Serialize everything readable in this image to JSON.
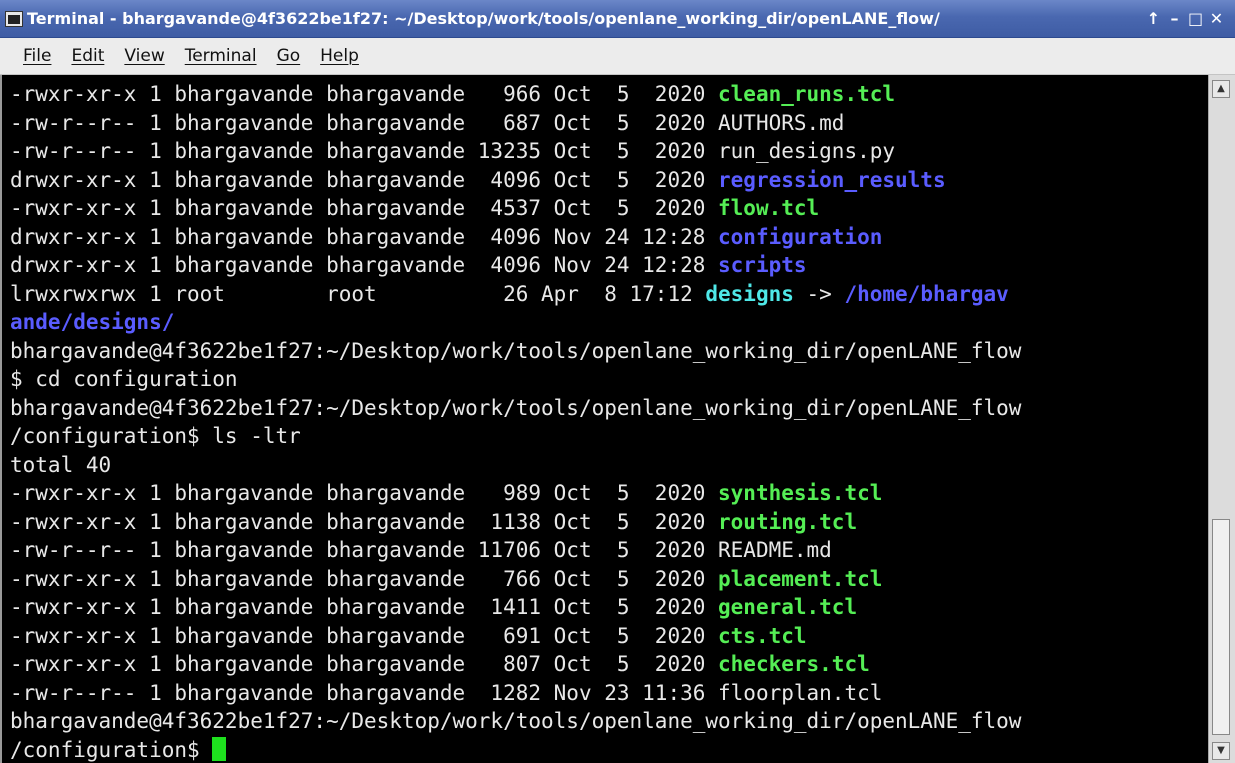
{
  "window": {
    "title": "Terminal - bhargavande@4f3622be1f27: ~/Desktop/work/tools/openlane_working_dir/openLANE_flow/",
    "controls": [
      "↑",
      "–",
      "□",
      "✕"
    ]
  },
  "menubar": {
    "items": [
      "File",
      "Edit",
      "View",
      "Terminal",
      "Go",
      "Help"
    ]
  },
  "terminal": {
    "lines": [
      {
        "prefix": "-rwxr-xr-x 1 bhargavande bhargavande   966 Oct  5  2020 ",
        "name": "clean_runs.tcl",
        "color": "green"
      },
      {
        "prefix": "-rw-r--r-- 1 bhargavande bhargavande   687 Oct  5  2020 ",
        "name": "AUTHORS.md",
        "color": "plain"
      },
      {
        "prefix": "-rw-r--r-- 1 bhargavande bhargavande 13235 Oct  5  2020 ",
        "name": "run_designs.py",
        "color": "plain"
      },
      {
        "prefix": "drwxr-xr-x 1 bhargavande bhargavande  4096 Oct  5  2020 ",
        "name": "regression_results",
        "color": "blue"
      },
      {
        "prefix": "-rwxr-xr-x 1 bhargavande bhargavande  4537 Oct  5  2020 ",
        "name": "flow.tcl",
        "color": "green"
      },
      {
        "prefix": "drwxr-xr-x 1 bhargavande bhargavande  4096 Nov 24 12:28 ",
        "name": "configuration",
        "color": "blue"
      },
      {
        "prefix": "drwxr-xr-x 1 bhargavande bhargavande  4096 Nov 24 12:28 ",
        "name": "scripts",
        "color": "blue"
      },
      {
        "prefix": "lrwxrwxrwx 1 root        root          26 Apr  8 17:12 ",
        "name": "designs",
        "color": "cyan",
        "suffix": " -> ",
        "target": "/home/bhargav"
      },
      {
        "prefix": "",
        "name": "ande/designs/",
        "color": "blue"
      },
      {
        "prefix": "bhargavande@4f3622be1f27:~/Desktop/work/tools/openlane_working_dir/openLANE_flow",
        "name": "",
        "color": "plain"
      },
      {
        "prefix": "$ cd configuration",
        "name": "",
        "color": "plain"
      },
      {
        "prefix": "bhargavande@4f3622be1f27:~/Desktop/work/tools/openlane_working_dir/openLANE_flow",
        "name": "",
        "color": "plain"
      },
      {
        "prefix": "/configuration$ ls -ltr",
        "name": "",
        "color": "plain"
      },
      {
        "prefix": "total 40",
        "name": "",
        "color": "plain"
      },
      {
        "prefix": "-rwxr-xr-x 1 bhargavande bhargavande   989 Oct  5  2020 ",
        "name": "synthesis.tcl",
        "color": "green"
      },
      {
        "prefix": "-rwxr-xr-x 1 bhargavande bhargavande  1138 Oct  5  2020 ",
        "name": "routing.tcl",
        "color": "green"
      },
      {
        "prefix": "-rw-r--r-- 1 bhargavande bhargavande 11706 Oct  5  2020 ",
        "name": "README.md",
        "color": "plain"
      },
      {
        "prefix": "-rwxr-xr-x 1 bhargavande bhargavande   766 Oct  5  2020 ",
        "name": "placement.tcl",
        "color": "green"
      },
      {
        "prefix": "-rwxr-xr-x 1 bhargavande bhargavande  1411 Oct  5  2020 ",
        "name": "general.tcl",
        "color": "green"
      },
      {
        "prefix": "-rwxr-xr-x 1 bhargavande bhargavande   691 Oct  5  2020 ",
        "name": "cts.tcl",
        "color": "green"
      },
      {
        "prefix": "-rwxr-xr-x 1 bhargavande bhargavande   807 Oct  5  2020 ",
        "name": "checkers.tcl",
        "color": "green"
      },
      {
        "prefix": "-rw-r--r-- 1 bhargavande bhargavande  1282 Nov 23 11:36 ",
        "name": "floorplan.tcl",
        "color": "plain"
      },
      {
        "prefix": "bhargavande@4f3622be1f27:~/Desktop/work/tools/openlane_working_dir/openLANE_flow",
        "name": "",
        "color": "plain"
      },
      {
        "prefix": "/configuration$ ",
        "name": "",
        "color": "plain",
        "cursor": true
      }
    ]
  },
  "colors": {
    "green": "#55ee55",
    "blue": "#5a5cff",
    "cyan": "#4fe8e8",
    "plain": "#e8e8e8",
    "cursor": "#1ee01e"
  }
}
